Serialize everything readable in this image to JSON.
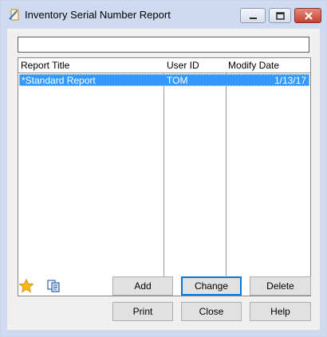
{
  "window": {
    "title": "Inventory Serial Number Report",
    "colors": {
      "frame": "#cfdaf0",
      "selection": "#3399ff",
      "close_button": "#c7412f"
    }
  },
  "filter": {
    "value": "",
    "placeholder": ""
  },
  "table": {
    "columns": [
      "Report Title",
      "User ID",
      "Modify Date"
    ],
    "rows": [
      [
        "*Standard Report",
        "TOM",
        "1/13/17"
      ]
    ]
  },
  "icons": {
    "favorite": "star-icon",
    "copy": "copy-icon"
  },
  "buttons": {
    "add": "Add",
    "change": "Change",
    "delete": "Delete",
    "print": "Print",
    "close": "Close",
    "help": "Help"
  }
}
